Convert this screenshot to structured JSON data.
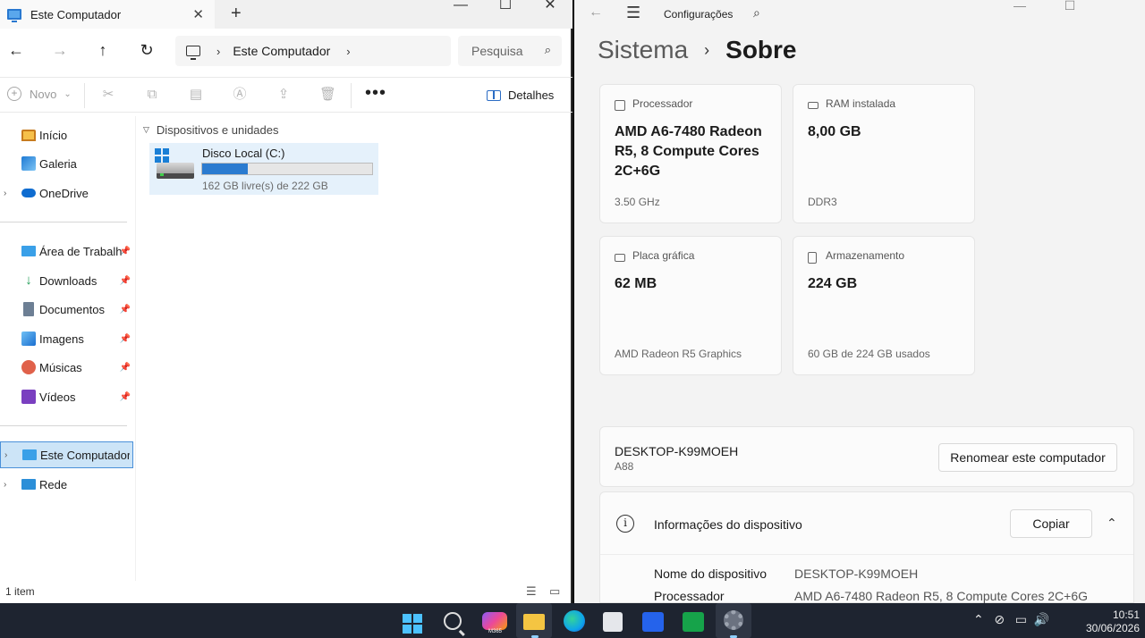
{
  "explorer": {
    "tab_title": "Este Computador",
    "address": "Este Computador",
    "search_placeholder": "Pesquisa",
    "cmd": {
      "new_label": "Novo",
      "details_label": "Detalhes"
    },
    "sidebar": {
      "top_items": [
        "Início",
        "Galeria",
        "OneDrive"
      ],
      "pinned_items": [
        "Área de Trabalho",
        "Downloads",
        "Documentos",
        "Imagens",
        "Músicas",
        "Vídeos"
      ],
      "bottom_items": [
        "Este Computador",
        "Rede"
      ]
    },
    "group_header": "Dispositivos e unidades",
    "drive": {
      "name": "Disco Local (C:)",
      "free_text": "162 GB livre(s) de 222 GB",
      "used_fraction": 0.27
    },
    "status_count": "1 item"
  },
  "settings": {
    "app_name": "Configurações",
    "breadcrumb": "Sistema",
    "page_title": "Sobre",
    "cards": [
      {
        "label": "Processador",
        "value": "AMD A6-7480 Radeon R5, 8 Compute Cores 2C+6G",
        "sub": "3.50 GHz",
        "icon": "processor-icon"
      },
      {
        "label": "RAM instalada",
        "value": "8,00 GB",
        "sub": "DDR3",
        "icon": "ram-icon"
      },
      {
        "label": "Placa gráfica",
        "value": "62 MB",
        "sub": "AMD Radeon R5 Graphics",
        "icon": "gpu-icon"
      },
      {
        "label": "Armazenamento",
        "value": "224 GB",
        "sub": "60 GB de 224 GB usados",
        "icon": "storage-icon"
      }
    ],
    "device": {
      "name": "DESKTOP-K99MOEH",
      "model": "A88",
      "rename_label": "Renomear este computador"
    },
    "info": {
      "title": "Informações do dispositivo",
      "copy_label": "Copiar",
      "rows": [
        {
          "key": "Nome do dispositivo",
          "value": "DESKTOP-K99MOEH"
        },
        {
          "key": "Processador",
          "value": "AMD A6-7480 Radeon R5, 8 Compute Cores 2C+6G"
        }
      ]
    }
  },
  "taskbar": {
    "time": "10:51",
    "date": "30/06/2026",
    "m365_badge": "M365"
  },
  "colors": {
    "accent": "#2a7bd0",
    "selection": "#cce4f7",
    "taskbar": "#1e2430"
  }
}
